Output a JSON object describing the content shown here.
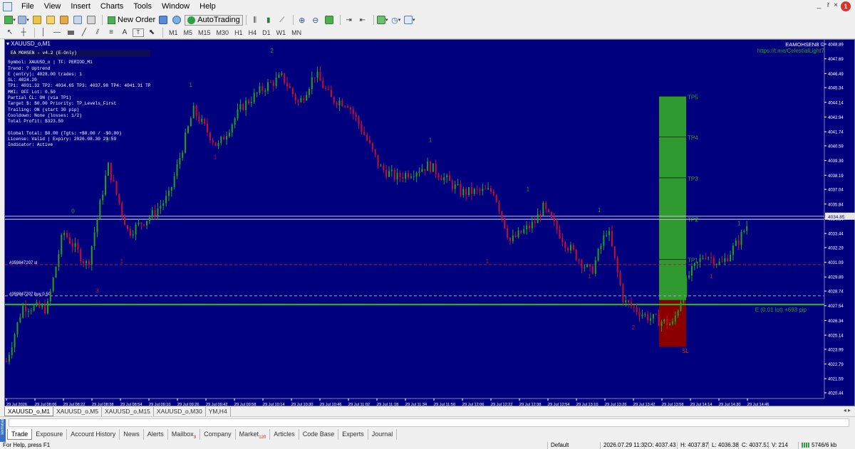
{
  "menubar": {
    "items": [
      "File",
      "View",
      "Insert",
      "Charts",
      "Tools",
      "Window",
      "Help"
    ],
    "min_label": "_",
    "restore_label": "ř",
    "close_label": "×",
    "badge": "1"
  },
  "toolbar": {
    "new_order": "New Order",
    "autotrading": "AutoTrading",
    "timeframes": [
      "M1",
      "M5",
      "M15",
      "M30",
      "H1",
      "H4",
      "D1",
      "W1",
      "MN"
    ],
    "text_tool": "A",
    "label_tool": "T"
  },
  "chart": {
    "title": "XAUUSD_o,M1",
    "info_header": "EA MOHSEN - v4.2 (E-Only)",
    "info_lines": [
      "Symbol:     XAUUSD_o  |  TF: PERIOD_M1",
      "Trend:      ? Uptrend",
      "E (entry): 4028.00  trades: 1",
      "SL:           4024.20",
      "TP1: 4031.32  TP2: 4034.65  TP3: 4037.98  TP4: 4041.31  TP5: 4044.63",
      "MMI:       OFF  Lot: 0.50",
      "Partial CL: ON (via TP1)",
      "Target $:   $0.00  Priority: TP_Levels_First",
      "Trailing:   ON (start 30 pip)",
      "Cooldown:   None (losses: 1/2)",
      "Total Profit: $323.50",
      "",
      "Global Total: $0.00  (Tgts: +$0.00 / -$0.00)",
      "License:    Valid  |  Expiry: 2026.08.30 23:59",
      "Indicator:  Active"
    ],
    "brand_name": "EAMOHSEN8",
    "brand_link": "https://t.me/CelestialLight7",
    "tp_labels": [
      "TP5",
      "TP4",
      "TP3",
      "TP2",
      "TP1"
    ],
    "sl_label": "SL",
    "entry_label": "E (0.01 lot) +693 pip",
    "order_labels": [
      "#359847207 sl",
      "#359847207 buy 0.50"
    ],
    "current_price": "4034.85",
    "price_ticks": [
      "4048.89",
      "4047.69",
      "4046.49",
      "4045.34",
      "4044.14",
      "4042.94",
      "4041.74",
      "4040.59",
      "4039.39",
      "4038.19",
      "4037.04",
      "4035.84",
      "4034.64",
      "4033.44",
      "4032.29",
      "4031.09",
      "4029.89",
      "4028.74",
      "4027.54",
      "4026.34",
      "4025.14",
      "4023.99",
      "4022.79",
      "4021.59",
      "4020.44"
    ],
    "time_ticks": [
      "29 Jul 2026",
      "29 Jul 08:06",
      "29 Jul 08:22",
      "29 Jul 08:38",
      "29 Jul 08:54",
      "29 Jul 09:10",
      "29 Jul 09:26",
      "29 Jul 09:42",
      "29 Jul 09:58",
      "29 Jul 10:14",
      "29 Jul 10:30",
      "29 Jul 10:46",
      "29 Jul 11:02",
      "29 Jul 11:18",
      "29 Jul 11:34",
      "29 Jul 11:50",
      "29 Jul 12:06",
      "29 Jul 12:22",
      "29 Jul 12:38",
      "29 Jul 12:54",
      "29 Jul 13:10",
      "29 Jul 13:26",
      "29 Jul 13:42",
      "29 Jul 13:58",
      "29 Jul 14:14",
      "29 Jul 14:30",
      "29 Jul 14:46"
    ],
    "wave_labels": [
      {
        "t": "3",
        "x": 0.11,
        "p": 4028.6
      },
      {
        "t": "0",
        "x": 0.08,
        "p": 4035.1
      },
      {
        "t": "1",
        "x": 0.14,
        "p": 4031.0
      },
      {
        "t": "3",
        "x": 0.122,
        "p": 4040.9
      },
      {
        "t": "1",
        "x": 0.225,
        "p": 4045.4
      },
      {
        "t": "1",
        "x": 0.255,
        "p": 4039.5
      },
      {
        "t": "2",
        "x": 0.325,
        "p": 4048.2
      },
      {
        "t": "1",
        "x": 0.52,
        "p": 4040.9
      },
      {
        "t": "1",
        "x": 0.64,
        "p": 4036.9
      },
      {
        "t": "1",
        "x": 0.59,
        "p": 4031.0
      },
      {
        "t": "1",
        "x": 0.716,
        "p": 4029.8
      },
      {
        "t": "1",
        "x": 0.728,
        "p": 4035.2
      },
      {
        "t": "2",
        "x": 0.77,
        "p": 4025.6
      },
      {
        "t": "2",
        "x": 0.848,
        "p": 4034.4
      },
      {
        "t": "1",
        "x": 0.866,
        "p": 4029.8
      },
      {
        "t": "1",
        "x": 0.9,
        "p": 4034.1
      }
    ]
  },
  "chart_tabs": [
    "XAUUSD_o,M1",
    "XAUUSD_o,M5",
    "XAUUSD_o,M15",
    "XAUUSD_o,M30",
    "YM,H4"
  ],
  "terminal": {
    "side_label": "Terminal",
    "tabs": [
      {
        "label": "Trade",
        "badge": ""
      },
      {
        "label": "Exposure",
        "badge": ""
      },
      {
        "label": "Account History",
        "badge": ""
      },
      {
        "label": "News",
        "badge": ""
      },
      {
        "label": "Alerts",
        "badge": ""
      },
      {
        "label": "Mailbox",
        "badge": "3"
      },
      {
        "label": "Company",
        "badge": ""
      },
      {
        "label": "Market",
        "badge": "120"
      },
      {
        "label": "Articles",
        "badge": ""
      },
      {
        "label": "Code Base",
        "badge": ""
      },
      {
        "label": "Experts",
        "badge": ""
      },
      {
        "label": "Journal",
        "badge": ""
      }
    ]
  },
  "status": {
    "help": "For Help, press F1",
    "profile": "Default",
    "datetime": "2026.07.29 11:32",
    "open": "O: 4037.43",
    "high": "H: 4037.87",
    "low": "L: 4036.38",
    "close": "C: 4037.51",
    "volume": "V: 214",
    "traffic": "5746/6 kb"
  },
  "colors": {
    "bg": "#00007f",
    "bull": "#1fa31f",
    "bear": "#c8102e",
    "tp_zone": "#2f9a2f",
    "sl_zone": "#8a0000",
    "entry_line": "#20c020"
  }
}
